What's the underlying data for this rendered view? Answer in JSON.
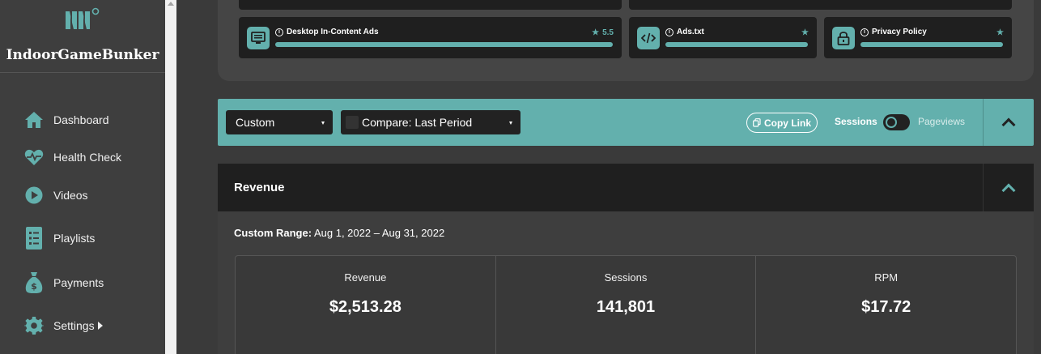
{
  "sidebar": {
    "site_name": "IndoorGameBunker",
    "items": [
      {
        "label": "Dashboard",
        "icon": "home-icon"
      },
      {
        "label": "Health Check",
        "icon": "heart-pulse-icon"
      },
      {
        "label": "Videos",
        "icon": "play-circle-icon"
      },
      {
        "label": "Playlists",
        "icon": "list-icon"
      },
      {
        "label": "Payments",
        "icon": "money-bag-icon"
      },
      {
        "label": "Settings",
        "icon": "gear-icon"
      }
    ]
  },
  "health_cards": [
    {
      "title": "Desktop In-Content Ads",
      "score": "5.5",
      "icon": "monitor-icon"
    },
    {
      "title": "Ads.txt",
      "score": "",
      "icon": "code-icon"
    },
    {
      "title": "Privacy Policy",
      "score": "",
      "icon": "lock-icon"
    }
  ],
  "filters": {
    "date_range": "Custom",
    "compare": "Compare: Last Period",
    "copy_link": "Copy Link",
    "toggle_left": "Sessions",
    "toggle_right": "Pageviews"
  },
  "revenue": {
    "title": "Revenue",
    "range_label": "Custom Range:",
    "range_value": "Aug 1, 2022 – Aug 31, 2022",
    "stats": [
      {
        "label": "Revenue",
        "value": "$2,513.28"
      },
      {
        "label": "Sessions",
        "value": "141,801"
      },
      {
        "label": "RPM",
        "value": "$17.72"
      }
    ]
  },
  "colors": {
    "accent": "#63b0ad",
    "sidebar_bg": "#3e3e3e",
    "card_bg": "#1f1f1f"
  }
}
